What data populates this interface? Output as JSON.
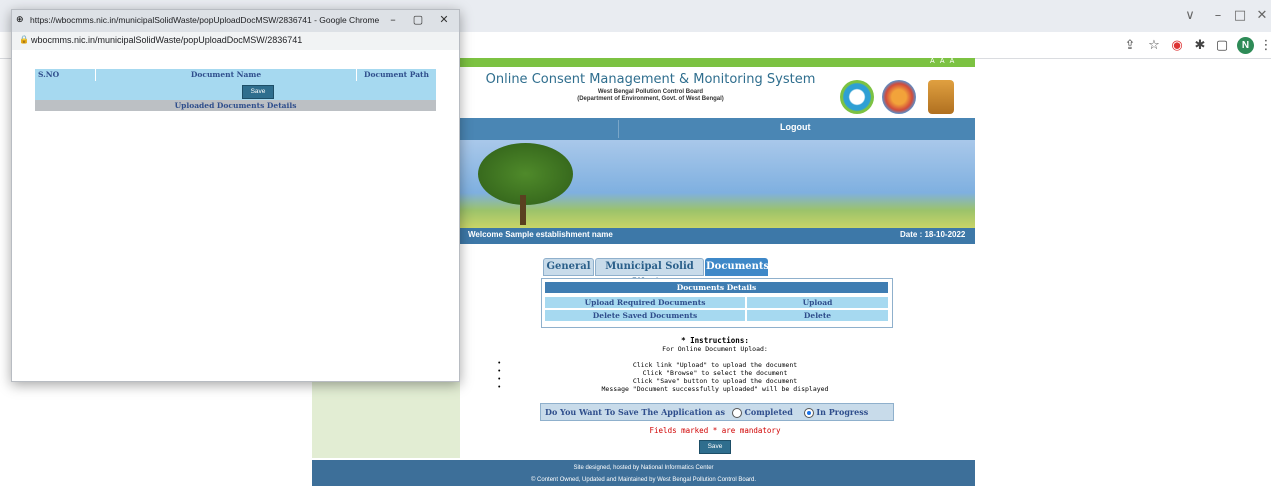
{
  "browser": {
    "avatar_letter": "N",
    "controls": [
      "∨",
      "–",
      "□",
      "✕"
    ],
    "toolbar_icons": [
      "share-icon",
      "star-icon",
      "extension-icon",
      "puzzle-icon",
      "sidepanel-icon"
    ]
  },
  "popup": {
    "window_title": "https://wbocmms.nic.in/municipalSolidWaste/popUploadDocMSW/2836741 - Google Chrome",
    "url": "wbocmms.nic.in/municipalSolidWaste/popUploadDocMSW/2836741",
    "minimize": "–",
    "maximize": "▢",
    "close": "✕",
    "table": {
      "col_sno": "S.NO",
      "col_name": "Document Name",
      "col_path": "Document Path",
      "save": "Save",
      "footer": "Uploaded Documents Details"
    }
  },
  "page": {
    "title": "Online Consent Management & Monitoring System",
    "sub1": "West Bengal Pollution Control Board",
    "sub2": "(Department of Environment, Govt. of West Bengal)",
    "font_size_ctrls": "A A A",
    "nav_logout": "Logout",
    "welcome": "Welcome Sample establishment name",
    "date": "Date : 18-10-2022",
    "tabs": [
      {
        "label": "General",
        "active": false
      },
      {
        "label": "Municipal Solid Waste",
        "active": false
      },
      {
        "label": "Documents",
        "active": true
      }
    ],
    "docs": {
      "header": "Documents Details",
      "row1_label": "Upload Required Documents",
      "row1_action": "Upload",
      "row2_label": "Delete Saved Documents",
      "row2_action": "Delete"
    },
    "instructions": {
      "heading": "* Instructions:",
      "sub": "For Online Document Upload:",
      "lines": [
        "Click link \"Upload\" to upload the document",
        "Click \"Browse\" to select the document",
        "Click \"Save\" button to upload the document",
        "Message \"Document successfully uploaded\" will be displayed"
      ]
    },
    "save_question": "Do You Want To Save The Application as",
    "option_completed": "Completed",
    "option_in_progress": "In Progress",
    "selected_option": "In Progress",
    "mandatory": "Fields marked * are mandatory",
    "save": "Save",
    "footer1": "Site designed, hosted by National Informatics Center",
    "footer2": "© Content Owned, Updated and Maintained by West Bengal Pollution Control Board."
  },
  "colors": {
    "nav": "#4a86b4",
    "accent_green": "#7cc242",
    "tab_active": "#3e88c8",
    "cell": "#a6d9f0"
  }
}
